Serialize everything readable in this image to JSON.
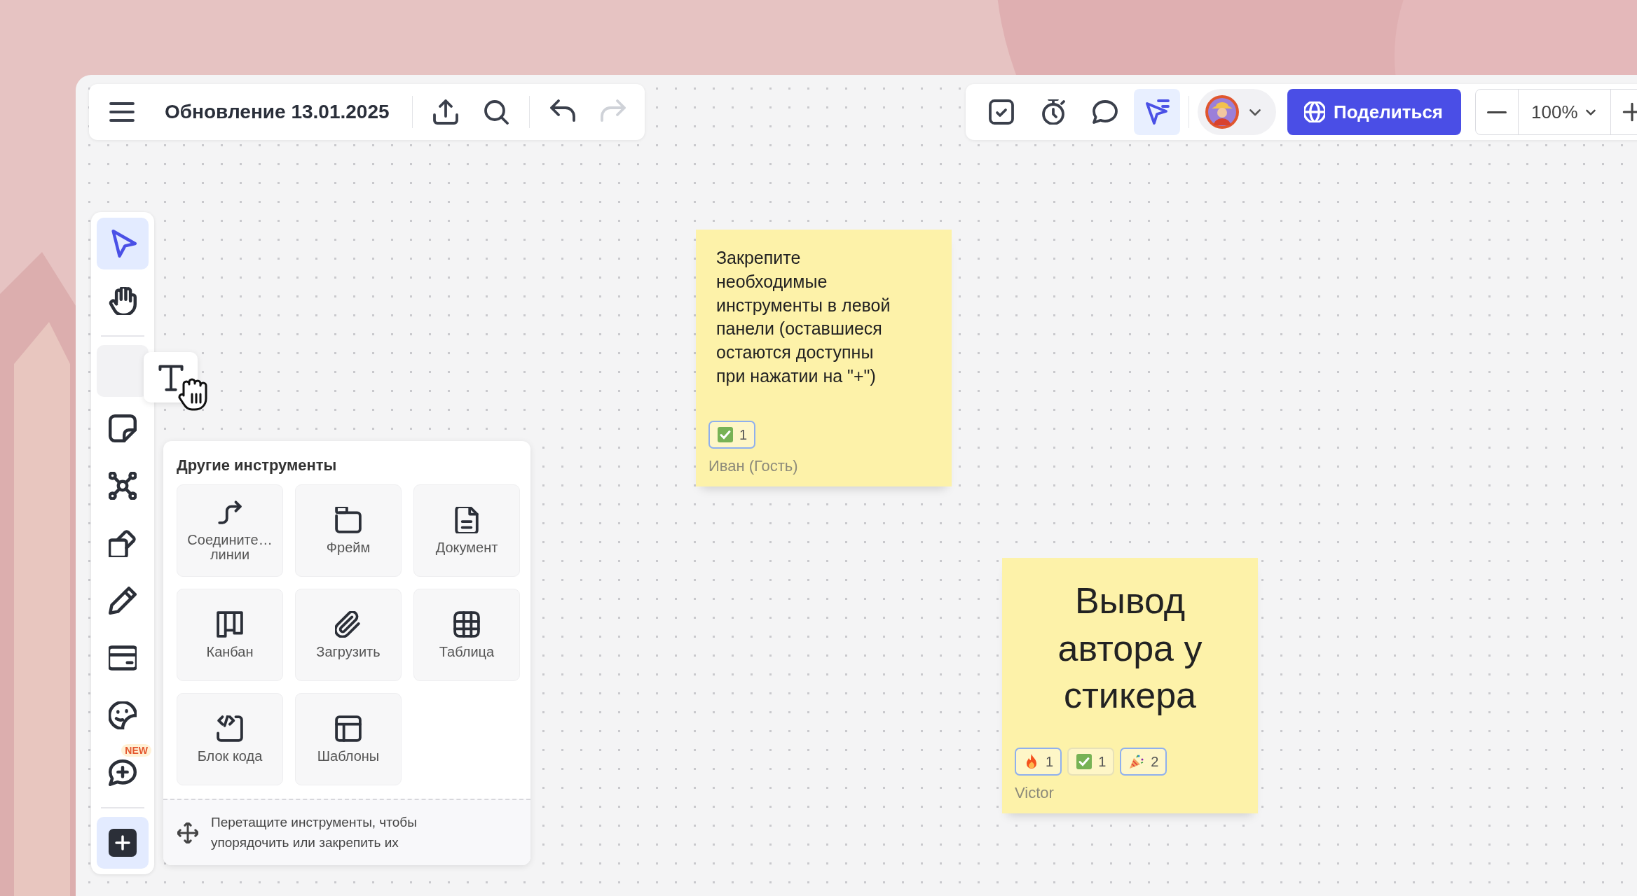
{
  "board": {
    "title": "Обновление 13.01.2025"
  },
  "header_actions": [
    {
      "kind": "export",
      "disabled": false
    },
    {
      "kind": "search",
      "disabled": false
    },
    {
      "kind": "undo",
      "disabled": false
    },
    {
      "kind": "redo",
      "disabled": true
    }
  ],
  "top_tools": [
    {
      "kind": "tasks",
      "selected": false
    },
    {
      "kind": "timer",
      "selected": false
    },
    {
      "kind": "comment",
      "selected": false
    },
    {
      "kind": "presentation",
      "selected": true
    }
  ],
  "share_button": {
    "label": "Поделиться"
  },
  "zoom": {
    "value": "100%"
  },
  "left_tools": [
    {
      "kind": "select",
      "selected": true
    },
    {
      "kind": "hand",
      "selected": false
    },
    {
      "kind": "divider"
    },
    {
      "kind": "placeholder"
    },
    {
      "kind": "sticky",
      "selected": false
    },
    {
      "kind": "mindmap",
      "selected": false
    },
    {
      "kind": "shapes",
      "selected": false
    },
    {
      "kind": "pen",
      "selected": false
    },
    {
      "kind": "card",
      "selected": false
    },
    {
      "kind": "sticker",
      "selected": false
    },
    {
      "kind": "comment_plus",
      "selected": false,
      "badge": "NEW"
    },
    {
      "kind": "divider"
    },
    {
      "kind": "add",
      "selected": true
    }
  ],
  "dragged_tool": {
    "kind": "text"
  },
  "more_tools": {
    "title": "Другие инструменты",
    "items": [
      {
        "kind": "connector",
        "label": "Соедините…\nлинии"
      },
      {
        "kind": "frame",
        "label": "Фрейм"
      },
      {
        "kind": "document",
        "label": "Документ"
      },
      {
        "kind": "kanban",
        "label": "Канбан"
      },
      {
        "kind": "upload",
        "label": "Загрузить"
      },
      {
        "kind": "table",
        "label": "Таблица"
      },
      {
        "kind": "code",
        "label": "Блок кода"
      },
      {
        "kind": "templates",
        "label": "Шаблоны"
      }
    ],
    "hint": "Перетащите инструменты, чтобы\nупорядочить или закрепить их"
  },
  "stickies": [
    {
      "kind": "small",
      "text": "Закрепите\nнеобходимые\nинструменты в левой\nпанели (оставшиеся\nостаются доступны\nпри нажатии на \"+\")",
      "reactions": [
        {
          "kind": "check",
          "count": "1",
          "selected": true
        }
      ],
      "author": "Иван (Гость)"
    },
    {
      "kind": "large",
      "text": "Вывод\nавтора у\nстикера",
      "reactions": [
        {
          "kind": "fire",
          "count": "1",
          "selected": true
        },
        {
          "kind": "check",
          "count": "1",
          "selected": false
        },
        {
          "kind": "party",
          "count": "2",
          "selected": true
        }
      ],
      "author": "Victor"
    }
  ]
}
